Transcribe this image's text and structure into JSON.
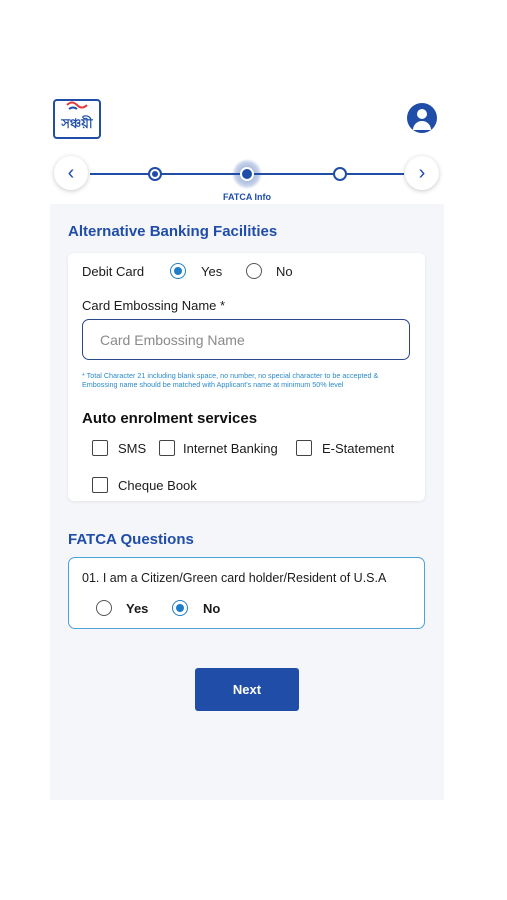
{
  "header": {
    "logo_text": "সঞ্চয়ী",
    "profile_icon": "user-circle-icon"
  },
  "stepper": {
    "prev_icon": "chevron-left-icon",
    "next_icon": "chevron-right-icon",
    "current_label": "FATCA Info"
  },
  "alt_banking": {
    "title": "Alternative Banking Facilities",
    "debit_card": {
      "label": "Debit Card",
      "yes": "Yes",
      "no": "No",
      "selected": "Yes"
    },
    "embossing": {
      "label": "Card Embossing Name *",
      "placeholder": "Card Embossing Name",
      "value": "",
      "hint": "* Total Character 21 including blank space, no number, no special character to be accepted & Embossing name should be matched with Applicant's name at minimum 50% level"
    },
    "auto_enrolment": {
      "title": "Auto enrolment services",
      "options": [
        "SMS",
        "Internet Banking",
        "E-Statement",
        "Cheque Book"
      ]
    }
  },
  "fatca": {
    "title": "FATCA Questions",
    "question": "01. I am a Citizen/Green card holder/Resident of U.S.A",
    "yes": "Yes",
    "no": "No",
    "selected": "No"
  },
  "actions": {
    "next_label": "Next"
  },
  "colors": {
    "primary": "#1f4da8",
    "accent": "#1f7ec7",
    "hint": "#2b8ac9",
    "background": "#f5f6fa"
  }
}
